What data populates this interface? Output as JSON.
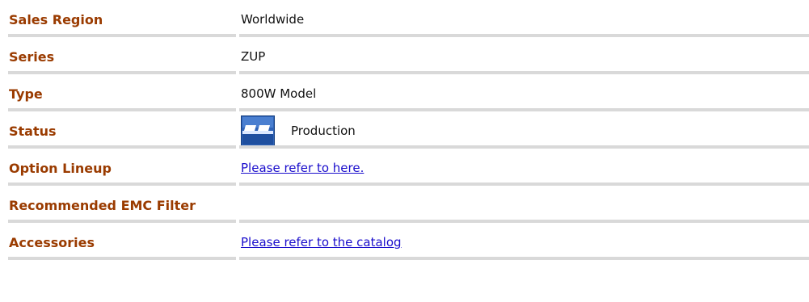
{
  "specs": [
    {
      "label": "Sales Region",
      "value": "Worldwide"
    },
    {
      "label": "Series",
      "value": "ZUP"
    },
    {
      "label": "Type",
      "value": "800W Model"
    },
    {
      "label": "Status",
      "value": "Production",
      "icon": "production-status-icon"
    },
    {
      "label": "Option Lineup",
      "value": "Please refer to here.",
      "link": true
    },
    {
      "label": "Recommended EMC Filter",
      "value": ""
    },
    {
      "label": "Accessories",
      "value": "Please refer to the catalog",
      "link": true
    }
  ],
  "colors": {
    "label": "#9a3b00",
    "link": "#1a0dcc",
    "divider": "#d9d9d9",
    "status_icon": "#2f63b8"
  }
}
